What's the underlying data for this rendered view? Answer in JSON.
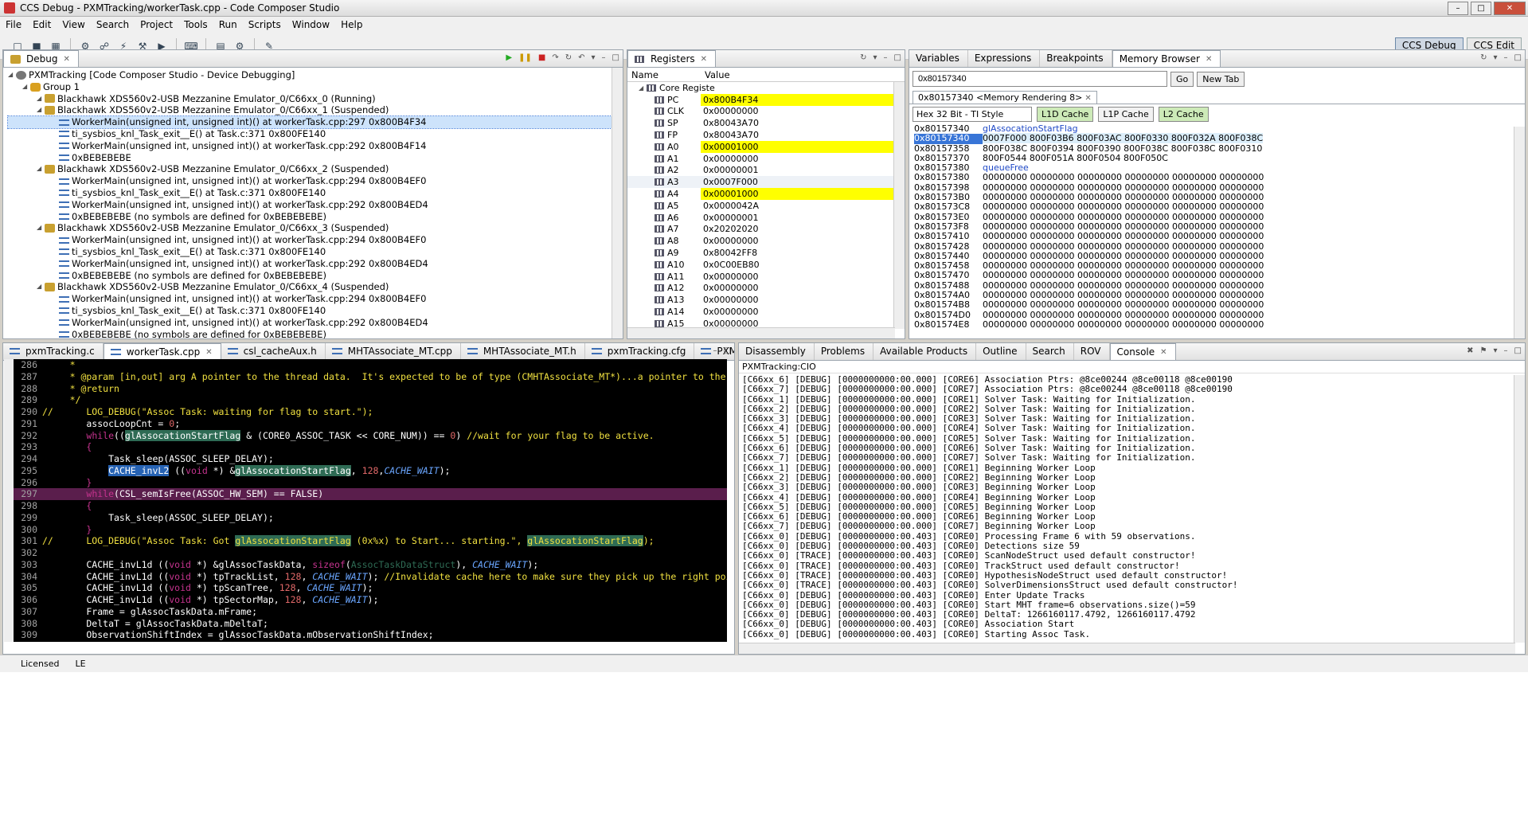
{
  "window": {
    "title": "CCS Debug - PXMTracking/workerTask.cpp - Code Composer Studio"
  },
  "menu": [
    "File",
    "Edit",
    "View",
    "Search",
    "Project",
    "Tools",
    "Run",
    "Scripts",
    "Window",
    "Help"
  ],
  "perspectives": [
    "CCS Debug",
    "CCS Edit"
  ],
  "debug_view": {
    "tab": "Debug",
    "rows": [
      {
        "indent": 0,
        "kind": "proj",
        "label": "PXMTracking [Code Composer Studio - Device Debugging]"
      },
      {
        "indent": 1,
        "kind": "grp",
        "label": "Group 1"
      },
      {
        "indent": 2,
        "kind": "core",
        "label": "Blackhawk XDS560v2-USB Mezzanine Emulator_0/C66xx_0 (Running)"
      },
      {
        "indent": 2,
        "kind": "core",
        "label": "Blackhawk XDS560v2-USB Mezzanine Emulator_0/C66xx_1 (Suspended)"
      },
      {
        "indent": 3,
        "kind": "frame",
        "label": "WorkerMain(unsigned int, unsigned int)() at workerTask.cpp:297 0x800B4F34",
        "selected": true
      },
      {
        "indent": 3,
        "kind": "frame",
        "label": "ti_sysbios_knl_Task_exit__E() at Task.c:371 0x800FE140"
      },
      {
        "indent": 3,
        "kind": "frame",
        "label": "WorkerMain(unsigned int, unsigned int)() at workerTask.cpp:292 0x800B4F14"
      },
      {
        "indent": 3,
        "kind": "frame",
        "label": "0xBEBEBEBE"
      },
      {
        "indent": 2,
        "kind": "core",
        "label": "Blackhawk XDS560v2-USB Mezzanine Emulator_0/C66xx_2 (Suspended)"
      },
      {
        "indent": 3,
        "kind": "frame",
        "label": "WorkerMain(unsigned int, unsigned int)() at workerTask.cpp:294 0x800B4EF0"
      },
      {
        "indent": 3,
        "kind": "frame",
        "label": "ti_sysbios_knl_Task_exit__E() at Task.c:371 0x800FE140"
      },
      {
        "indent": 3,
        "kind": "frame",
        "label": "WorkerMain(unsigned int, unsigned int)() at workerTask.cpp:292 0x800B4ED4"
      },
      {
        "indent": 3,
        "kind": "frame",
        "label": "0xBEBEBEBE  (no symbols are defined for 0xBEBEBEBE)"
      },
      {
        "indent": 2,
        "kind": "core",
        "label": "Blackhawk XDS560v2-USB Mezzanine Emulator_0/C66xx_3 (Suspended)"
      },
      {
        "indent": 3,
        "kind": "frame",
        "label": "WorkerMain(unsigned int, unsigned int)() at workerTask.cpp:294 0x800B4EF0"
      },
      {
        "indent": 3,
        "kind": "frame",
        "label": "ti_sysbios_knl_Task_exit__E() at Task.c:371 0x800FE140"
      },
      {
        "indent": 3,
        "kind": "frame",
        "label": "WorkerMain(unsigned int, unsigned int)() at workerTask.cpp:292 0x800B4ED4"
      },
      {
        "indent": 3,
        "kind": "frame",
        "label": "0xBEBEBEBE  (no symbols are defined for 0xBEBEBEBE)"
      },
      {
        "indent": 2,
        "kind": "core",
        "label": "Blackhawk XDS560v2-USB Mezzanine Emulator_0/C66xx_4 (Suspended)"
      },
      {
        "indent": 3,
        "kind": "frame",
        "label": "WorkerMain(unsigned int, unsigned int)() at workerTask.cpp:294 0x800B4EF0"
      },
      {
        "indent": 3,
        "kind": "frame",
        "label": "ti_sysbios_knl_Task_exit__E() at Task.c:371 0x800FE140"
      },
      {
        "indent": 3,
        "kind": "frame",
        "label": "WorkerMain(unsigned int, unsigned int)() at workerTask.cpp:292 0x800B4ED4"
      },
      {
        "indent": 3,
        "kind": "frame",
        "label": "0xBEBEBEBE  (no symbols are defined for 0xBEBEBEBE)"
      }
    ]
  },
  "registers_view": {
    "tab": "Registers",
    "col_name": "Name",
    "col_value": "Value",
    "group": "Core Registe",
    "rows": [
      {
        "n": "PC",
        "v": "0x800B4F34",
        "hl": true
      },
      {
        "n": "CLK",
        "v": "0x00000000"
      },
      {
        "n": "SP",
        "v": "0x80043A70"
      },
      {
        "n": "FP",
        "v": "0x80043A70"
      },
      {
        "n": "A0",
        "v": "0x00001000",
        "hl": true
      },
      {
        "n": "A1",
        "v": "0x00000000"
      },
      {
        "n": "A2",
        "v": "0x00000001"
      },
      {
        "n": "A3",
        "v": "0x0007F000"
      },
      {
        "n": "A4",
        "v": "0x00001000",
        "hl": true
      },
      {
        "n": "A5",
        "v": "0x0000042A"
      },
      {
        "n": "A6",
        "v": "0x00000001"
      },
      {
        "n": "A7",
        "v": "0x20202020"
      },
      {
        "n": "A8",
        "v": "0x00000000"
      },
      {
        "n": "A9",
        "v": "0x80042FF8"
      },
      {
        "n": "A10",
        "v": "0x0C00EB80"
      },
      {
        "n": "A11",
        "v": "0x00000000"
      },
      {
        "n": "A12",
        "v": "0x00000000"
      },
      {
        "n": "A13",
        "v": "0x00000000"
      },
      {
        "n": "A14",
        "v": "0x00000000"
      },
      {
        "n": "A15",
        "v": "0x00000000"
      }
    ]
  },
  "memory_view": {
    "tabs": [
      "Variables",
      "Expressions",
      "Breakpoints",
      "Memory Browser"
    ],
    "address": "0x80157340",
    "go": "Go",
    "new_tab": "New Tab",
    "rendering_tab": "0x80157340 <Memory Rendering 8>",
    "format": "Hex 32 Bit - TI Style",
    "caches": [
      "L1D Cache",
      "L1P Cache",
      "L2 Cache"
    ],
    "lines": [
      {
        "a": "0x80157340",
        "sym": "glAssocationStartFlag"
      },
      {
        "a": "0x80157340",
        "d": "0007F000 800F03B6 800F03AC 800F0330 800F032A 800F038C",
        "selected": true
      },
      {
        "a": "0x80157358",
        "d": "800F038C 800F0394 800F0390 800F038C 800F038C 800F0310"
      },
      {
        "a": "0x80157370",
        "d": "800F0544 800F051A 800F0504 800F050C"
      },
      {
        "a": "0x80157380",
        "sym": "queueFree"
      },
      {
        "a": "0x80157380",
        "d": "00000000 00000000 00000000 00000000 00000000 00000000"
      },
      {
        "a": "0x80157398",
        "d": "00000000 00000000 00000000 00000000 00000000 00000000"
      },
      {
        "a": "0x801573B0",
        "d": "00000000 00000000 00000000 00000000 00000000 00000000"
      },
      {
        "a": "0x801573C8",
        "d": "00000000 00000000 00000000 00000000 00000000 00000000"
      },
      {
        "a": "0x801573E0",
        "d": "00000000 00000000 00000000 00000000 00000000 00000000"
      },
      {
        "a": "0x801573F8",
        "d": "00000000 00000000 00000000 00000000 00000000 00000000"
      },
      {
        "a": "0x80157410",
        "d": "00000000 00000000 00000000 00000000 00000000 00000000"
      },
      {
        "a": "0x80157428",
        "d": "00000000 00000000 00000000 00000000 00000000 00000000"
      },
      {
        "a": "0x80157440",
        "d": "00000000 00000000 00000000 00000000 00000000 00000000"
      },
      {
        "a": "0x80157458",
        "d": "00000000 00000000 00000000 00000000 00000000 00000000"
      },
      {
        "a": "0x80157470",
        "d": "00000000 00000000 00000000 00000000 00000000 00000000"
      },
      {
        "a": "0x80157488",
        "d": "00000000 00000000 00000000 00000000 00000000 00000000"
      },
      {
        "a": "0x801574A0",
        "d": "00000000 00000000 00000000 00000000 00000000 00000000"
      },
      {
        "a": "0x801574B8",
        "d": "00000000 00000000 00000000 00000000 00000000 00000000"
      },
      {
        "a": "0x801574D0",
        "d": "00000000 00000000 00000000 00000000 00000000 00000000"
      },
      {
        "a": "0x801574E8",
        "d": "00000000 00000000 00000000 00000000 00000000 00000000"
      }
    ]
  },
  "editor": {
    "tabs": [
      "pxmTracking.c",
      "workerTask.cpp",
      "csl_cacheAux.h",
      "MHTAssociate_MT.cpp",
      "MHTAssociate_MT.h",
      "pxmTracking.cfg",
      "PXMTracking.map"
    ],
    "active_tab": 1
  },
  "console_view": {
    "tabs": [
      "Disassembly",
      "Problems",
      "Available Products",
      "Outline",
      "Search",
      "ROV",
      "Console"
    ],
    "title": "PXMTracking:CIO",
    "lines": [
      "[C66xx_6] [DEBUG] [0000000000:00.000] [CORE6] Association Ptrs: @8ce00244 @8ce00118 @8ce00190",
      "[C66xx_7] [DEBUG] [0000000000:00.000] [CORE7] Association Ptrs: @8ce00244 @8ce00118 @8ce00190",
      "[C66xx_1] [DEBUG] [0000000000:00.000] [CORE1] Solver Task: Waiting for Initialization.",
      "[C66xx_2] [DEBUG] [0000000000:00.000] [CORE2] Solver Task: Waiting for Initialization.",
      "[C66xx_3] [DEBUG] [0000000000:00.000] [CORE3] Solver Task: Waiting for Initialization.",
      "[C66xx_4] [DEBUG] [0000000000:00.000] [CORE4] Solver Task: Waiting for Initialization.",
      "[C66xx_5] [DEBUG] [0000000000:00.000] [CORE5] Solver Task: Waiting for Initialization.",
      "[C66xx_6] [DEBUG] [0000000000:00.000] [CORE6] Solver Task: Waiting for Initialization.",
      "[C66xx_7] [DEBUG] [0000000000:00.000] [CORE7] Solver Task: Waiting for Initialization.",
      "[C66xx_1] [DEBUG] [0000000000:00.000] [CORE1] Beginning Worker Loop",
      "[C66xx_2] [DEBUG] [0000000000:00.000] [CORE2] Beginning Worker Loop",
      "[C66xx_3] [DEBUG] [0000000000:00.000] [CORE3] Beginning Worker Loop",
      "[C66xx_4] [DEBUG] [0000000000:00.000] [CORE4] Beginning Worker Loop",
      "[C66xx_5] [DEBUG] [0000000000:00.000] [CORE5] Beginning Worker Loop",
      "[C66xx_6] [DEBUG] [0000000000:00.000] [CORE6] Beginning Worker Loop",
      "[C66xx_7] [DEBUG] [0000000000:00.000] [CORE7] Beginning Worker Loop",
      "[C66xx_0] [DEBUG] [0000000000:00.403] [CORE0] Processing Frame 6 with 59 observations.",
      "[C66xx_0] [DEBUG] [0000000000:00.403] [CORE0] Detections size 59",
      "[C66xx_0] [TRACE] [0000000000:00.403] [CORE0] ScanNodeStruct used default constructor!",
      "[C66xx_0] [TRACE] [0000000000:00.403] [CORE0] TrackStruct used default constructor!",
      "[C66xx_0] [TRACE] [0000000000:00.403] [CORE0] HypothesisNodeStruct used default constructor!",
      "[C66xx_0] [TRACE] [0000000000:00.403] [CORE0] SolverDimensionsStruct used default constructor!",
      "[C66xx_0] [DEBUG] [0000000000:00.403] [CORE0] Enter Update Tracks",
      "[C66xx_0] [DEBUG] [0000000000:00.403] [CORE0] Start MHT frame=6 observations.size()=59",
      "[C66xx_0] [DEBUG] [0000000000:00.403] [CORE0] DeltaT: 1266160117.4792, 1266160117.4792",
      "[C66xx_0] [DEBUG] [0000000000:00.403] [CORE0] Association Start",
      "[C66xx_0] [DEBUG] [0000000000:00.403] [CORE0] Starting Assoc Task."
    ]
  },
  "status": {
    "license": "Licensed",
    "endian": "LE"
  }
}
